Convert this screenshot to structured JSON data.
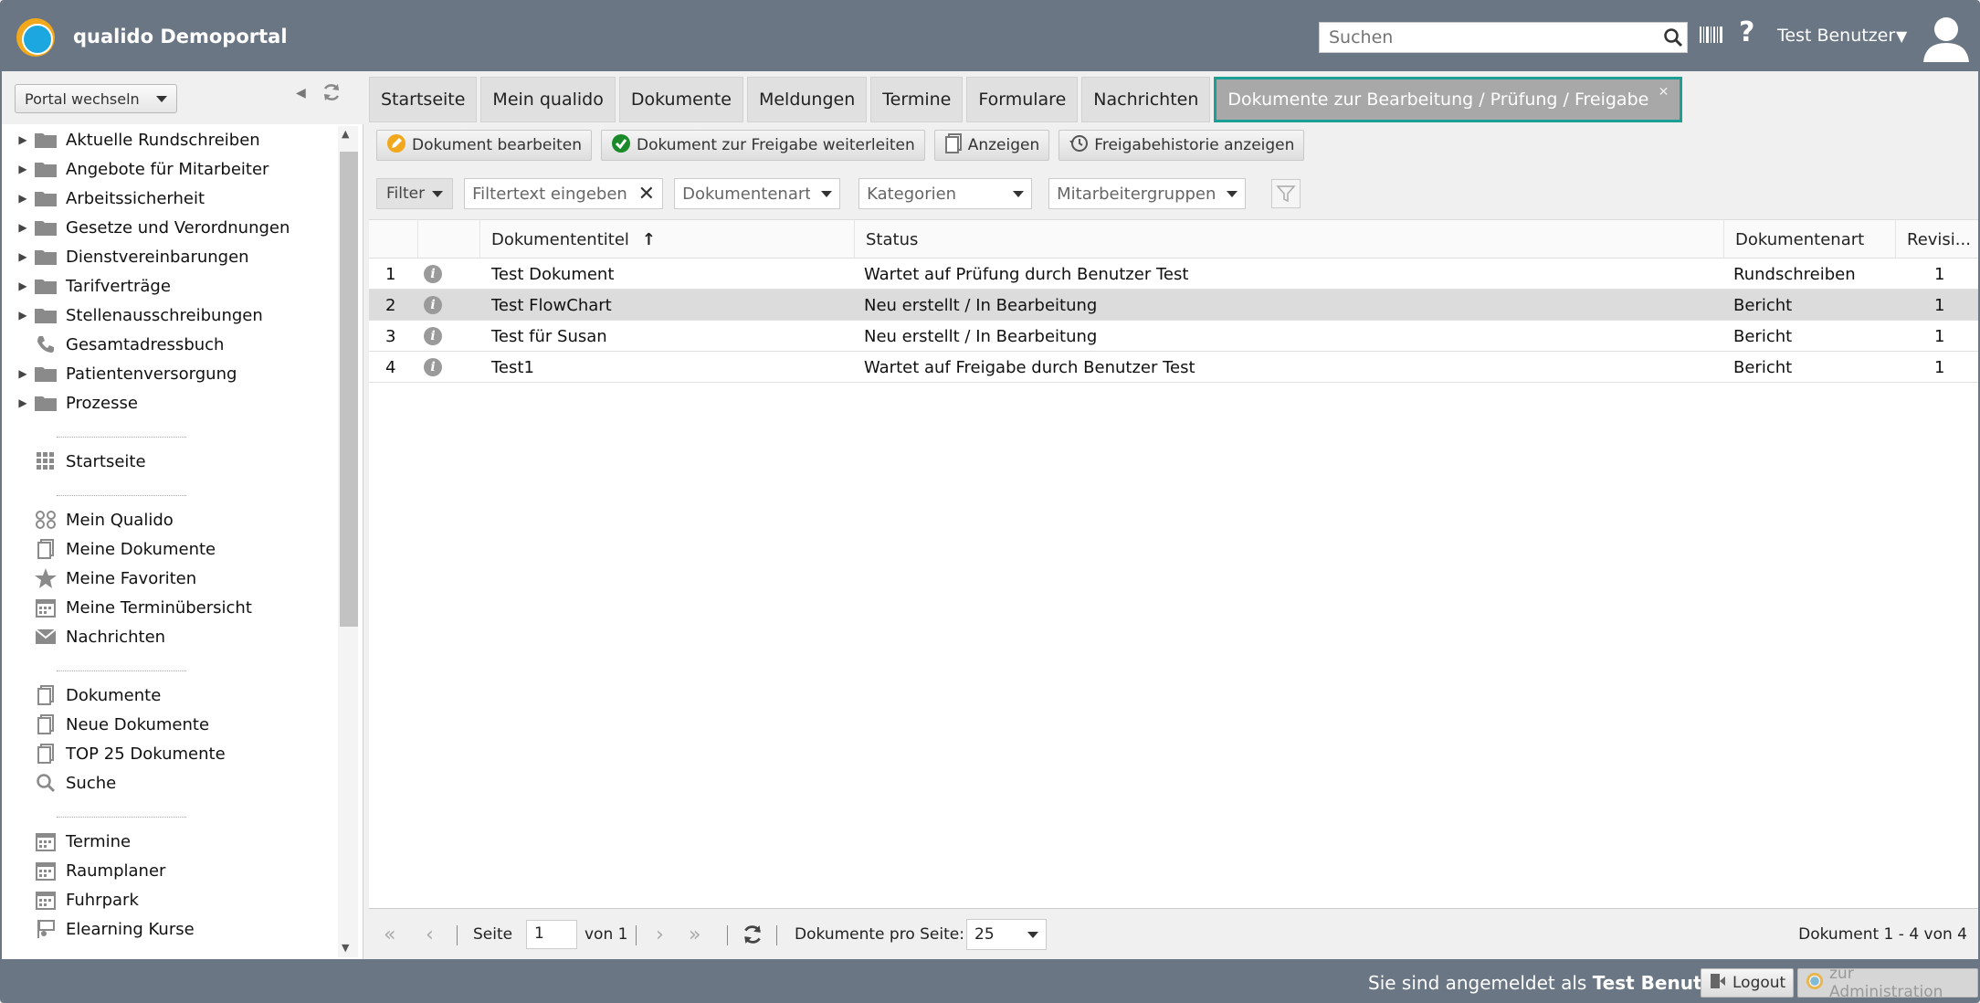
{
  "header": {
    "app_title": "qualido Demoportal",
    "search_placeholder": "Suchen",
    "help_label": "?",
    "user_name": "Test Benutzer"
  },
  "sidebar": {
    "portal_select": "Portal wechseln",
    "folders": [
      {
        "label": "Aktuelle Rundschreiben",
        "icon": "folder-icon"
      },
      {
        "label": "Angebote für Mitarbeiter",
        "icon": "folder-icon"
      },
      {
        "label": "Arbeitssicherheit",
        "icon": "folder-icon"
      },
      {
        "label": "Gesetze und Verordnungen",
        "icon": "folder-icon"
      },
      {
        "label": "Dienstvereinbarungen",
        "icon": "folder-icon"
      },
      {
        "label": "Tarifverträge",
        "icon": "folder-icon"
      },
      {
        "label": "Stellenausschreibungen",
        "icon": "folder-icon"
      },
      {
        "label": "Gesamtadressbuch",
        "icon": "phone-icon"
      },
      {
        "label": "Patientenversorgung",
        "icon": "folder-icon"
      },
      {
        "label": "Prozesse",
        "icon": "folder-icon"
      }
    ],
    "nav_home": "Startseite",
    "nav_personal": [
      {
        "label": "Mein Qualido",
        "icon": "mein-qualido-icon"
      },
      {
        "label": "Meine Dokumente",
        "icon": "document-icon"
      },
      {
        "label": "Meine Favoriten",
        "icon": "star-icon"
      },
      {
        "label": "Meine Terminübersicht",
        "icon": "calendar-icon"
      },
      {
        "label": "Nachrichten",
        "icon": "mail-icon"
      }
    ],
    "nav_documents": [
      {
        "label": "Dokumente",
        "icon": "document-icon"
      },
      {
        "label": "Neue Dokumente",
        "icon": "document-icon"
      },
      {
        "label": "TOP 25 Dokumente",
        "icon": "document-icon"
      },
      {
        "label": "Suche",
        "icon": "search-icon"
      }
    ],
    "nav_planning": [
      {
        "label": "Termine",
        "icon": "calendar-icon"
      },
      {
        "label": "Raumplaner",
        "icon": "calendar-icon"
      },
      {
        "label": "Fuhrpark",
        "icon": "calendar-icon"
      },
      {
        "label": "Elearning Kurse",
        "icon": "elearning-icon"
      }
    ]
  },
  "tabs": [
    "Startseite",
    "Mein qualido",
    "Dokumente",
    "Meldungen",
    "Termine",
    "Formulare",
    "Nachrichten",
    "Dokumente zur Bearbeitung / Prüfung / Freigabe"
  ],
  "toolbar": {
    "edit": "Dokument bearbeiten",
    "forward": "Dokument zur Freigabe weiterleiten",
    "show": "Anzeigen",
    "history": "Freigabehistorie anzeigen"
  },
  "filters": {
    "filter_btn": "Filter",
    "text_placeholder": "Filtertext eingeben",
    "doc_type": "Dokumentenarten",
    "categories": "Kategorien",
    "groups": "Mitarbeitergruppen"
  },
  "grid": {
    "columns": {
      "title": "Dokumententitel",
      "status": "Status",
      "type": "Dokumentenart",
      "revision": "Revisi..."
    },
    "sort_indicator": "↑",
    "rows": [
      {
        "num": "1",
        "title": "Test Dokument",
        "status": "Wartet auf Prüfung durch Benutzer Test",
        "type": "Rundschreiben",
        "revision": "1"
      },
      {
        "num": "2",
        "title": "Test FlowChart",
        "status": "Neu erstellt / In Bearbeitung",
        "type": "Bericht",
        "revision": "1"
      },
      {
        "num": "3",
        "title": "Test für Susan",
        "status": "Neu erstellt / In Bearbeitung",
        "type": "Bericht",
        "revision": "1"
      },
      {
        "num": "4",
        "title": "Test1",
        "status": "Wartet auf Freigabe durch Benutzer Test",
        "type": "Bericht",
        "revision": "1"
      }
    ]
  },
  "pager": {
    "page_label": "Seite",
    "page_value": "1",
    "of_label": "von 1",
    "per_page_label": "Dokumente pro Seite:",
    "per_page_value": "25",
    "summary": "Dokument 1 - 4 von 4"
  },
  "footer": {
    "logged_in_prefix": "Sie sind angemeldet als",
    "logged_in_user": "Test Benutzer",
    "logout": "Logout",
    "admin": "zur Administration"
  },
  "colors": {
    "header_bg": "#6a7683",
    "active_tab_border": "#1b9f95",
    "selected_row": "#dcdcdc"
  }
}
